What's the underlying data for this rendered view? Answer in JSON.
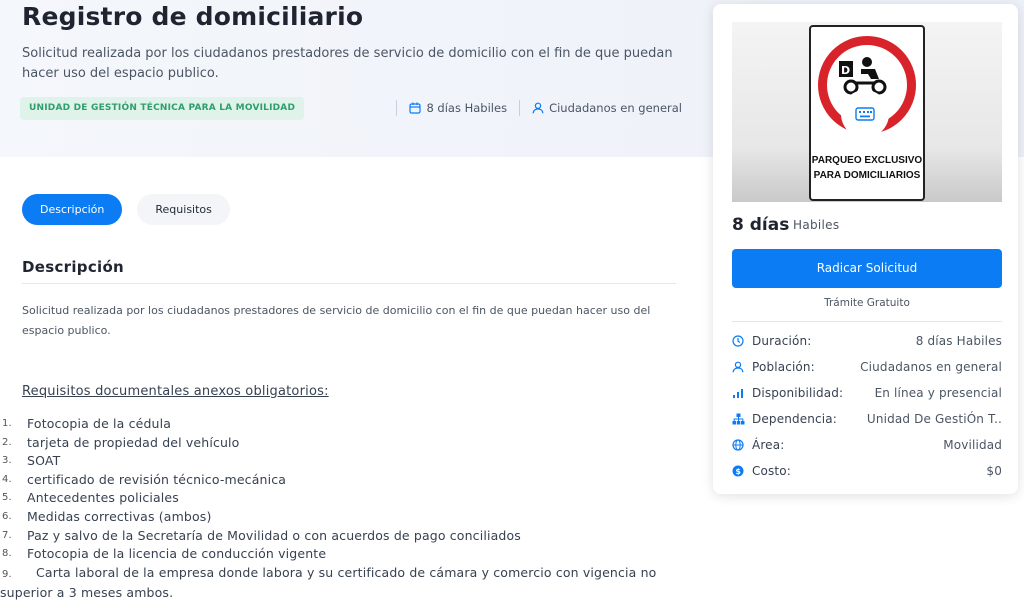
{
  "hero": {
    "title": "Registro de domiciliario",
    "description": "Solicitud realizada por los ciudadanos prestadores de servicio de domicilio con el fin de que puedan hacer uso del espacio publico.",
    "unit_badge": "UNIDAD DE GESTIÓN TÉCNICA PARA LA MOVILIDAD",
    "duration": "8 días Habiles",
    "population": "Ciudadanos en general"
  },
  "tabs": [
    {
      "label": "Descripción",
      "active": true
    },
    {
      "label": "Requisitos",
      "active": false
    }
  ],
  "description_section": {
    "title": "Descripción",
    "text": "Solicitud realizada por los ciudadanos prestadores de servicio de domicilio con el fin de que puedan hacer uso del espacio publico."
  },
  "requirements": {
    "heading": "Requisitos documentales anexos obligatorios:",
    "items": [
      {
        "num": "1.",
        "text": "Fotocopia de la cédula"
      },
      {
        "num": "2.",
        "text": "tarjeta de propiedad del vehículo"
      },
      {
        "num": "3.",
        "text": "SOAT"
      },
      {
        "num": "4.",
        "text": "certificado de revisión técnico-mecánica"
      },
      {
        "num": "5.",
        "text": "Antecedentes policiales"
      },
      {
        "num": "6.",
        "text": "Medidas correctivas (ambos)"
      },
      {
        "num": "7.",
        "text": "Paz y salvo de la Secretaría de Movilidad o con acuerdos de pago conciliados"
      },
      {
        "num": "8.",
        "text": "Fotocopia de la licencia de conducción vigente"
      },
      {
        "num": "9.",
        "text": "Carta laboral de la empresa donde labora y su certificado de cámara y comercio con vigencia no superior a 3 meses ambos."
      }
    ]
  },
  "card": {
    "sign_text": "PARQUEO EXCLUSIVO PARA DOMICILIARIOS",
    "days_number": "8 días",
    "days_label": "Habiles",
    "cta_label": "Radicar Solicitud",
    "cost_note": "Trámite Gratuito",
    "info": [
      {
        "icon": "clock-icon",
        "label": "Duración:",
        "value": "8 días Habiles"
      },
      {
        "icon": "user-icon",
        "label": "Población:",
        "value": "Ciudadanos en general"
      },
      {
        "icon": "signal-bars-icon",
        "label": "Disponibilidad:",
        "value": "En línea y presencial"
      },
      {
        "icon": "org-chart-icon",
        "label": "Dependencia:",
        "value": "Unidad De GestiÓn T.."
      },
      {
        "icon": "globe-icon",
        "label": "Área:",
        "value": "Movilidad"
      },
      {
        "icon": "coin-icon",
        "label": "Costo:",
        "value": "$0"
      }
    ]
  },
  "colors": {
    "primary": "#0b7cf3",
    "badge_bg": "#dff3ea",
    "badge_text": "#2e9e6a",
    "sign_red": "#d9232b"
  }
}
